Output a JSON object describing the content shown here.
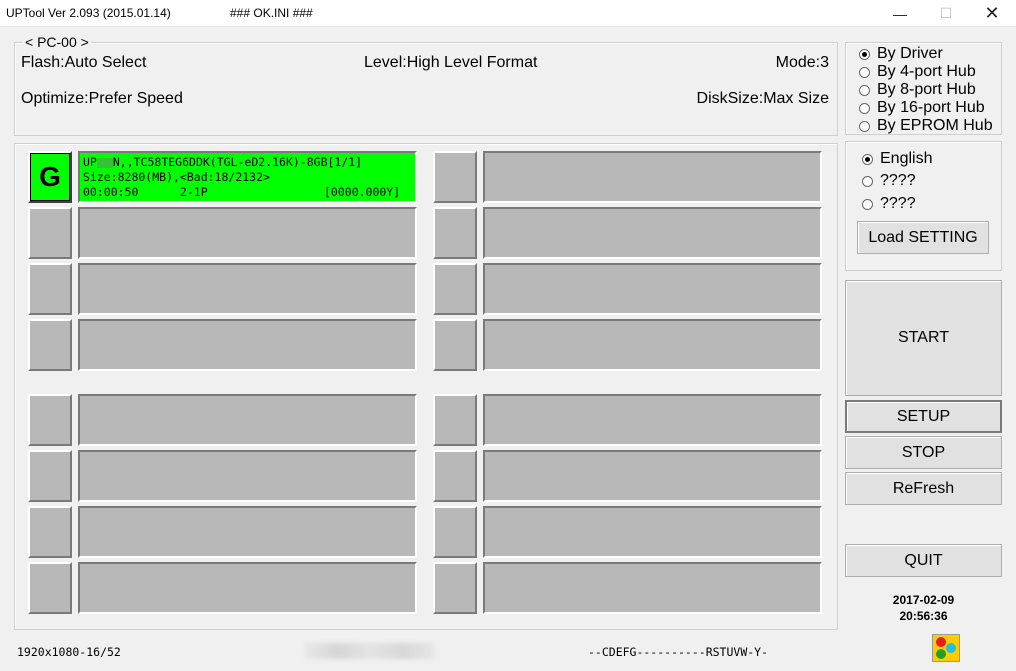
{
  "window": {
    "title": "UPTool Ver 2.093 (2015.01.14)",
    "ini": "### OK.INI ###",
    "min_glyph": "—",
    "max_glyph": "☐",
    "close_glyph": "✕"
  },
  "pc_panel": {
    "legend": "< PC-00 >",
    "flash": "Flash:Auto Select",
    "level": "Level:High Level Format",
    "mode": "Mode:3",
    "optimize": "Optimize:Prefer Speed",
    "disksize": "DiskSize:Max Size"
  },
  "hub_options": [
    {
      "label": "By Driver",
      "selected": true
    },
    {
      "label": "By 4-port Hub",
      "selected": false
    },
    {
      "label": "By 8-port Hub",
      "selected": false
    },
    {
      "label": "By 16-port Hub",
      "selected": false
    },
    {
      "label": "By EPROM Hub",
      "selected": false
    }
  ],
  "language_options": [
    {
      "label": "English",
      "selected": true
    },
    {
      "label": "????",
      "selected": false
    },
    {
      "label": "????",
      "selected": false
    }
  ],
  "buttons": {
    "load_setting": "Load SETTING",
    "start": "START",
    "setup": "SETUP",
    "stop": "STOP",
    "refresh": "ReFresh",
    "quit": "QUIT"
  },
  "active_slot": {
    "letter": "G",
    "line1_a": "UP",
    "line1_b": "N,,TC58TEG6DDK(TGL-eD2.16K)-8GB[1/1]",
    "line2": "Size:8280(MB),<Bad:18/2132>",
    "line3_left": "00:00:50      2-1P",
    "line3_right": "[0000.000Y]"
  },
  "status": {
    "resolution": "1920x1080-16/52",
    "drives": "--CDEFG----------RSTUVW-Y-",
    "date": "2017-02-09",
    "time": "20:56:36"
  },
  "colors": {
    "active_slot": "#00ff00",
    "idle_slot": "#b8b8b8"
  }
}
